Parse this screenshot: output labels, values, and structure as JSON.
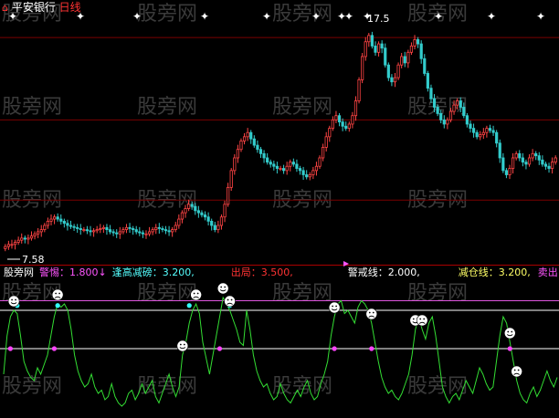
{
  "header": {
    "stock_name": "平安银行",
    "period": "日线",
    "name_color": "#ffffff",
    "period_color": "#ff3333"
  },
  "watermark": {
    "text": "股旁网",
    "color": "#3a3a3a"
  },
  "price_panel": {
    "high_label": "17.5",
    "low_label": "7.58",
    "star_color": "#ffffff",
    "up_color": "#ff4444",
    "down_color": "#33cccc",
    "grid_color": "#7a0000"
  },
  "indicator_panel": {
    "legend": [
      {
        "name": "股旁网",
        "value": "",
        "color": "#ffffff"
      },
      {
        "name": "警惕",
        "value": "1.800↓",
        "color": "#ff55ff"
      },
      {
        "name": "逢高减磅",
        "value": "3.200,",
        "color": "#55ffff"
      },
      {
        "name": "出局",
        "value": "3.500,",
        "color": "#ff3333"
      },
      {
        "name": "警戒线",
        "value": "2.000,",
        "color": "#ffffff"
      },
      {
        "name": "减仓线",
        "value": "3.200,",
        "color": "#ffff66"
      },
      {
        "name": "卖出",
        "value": "",
        "color": "#ff55ff"
      }
    ],
    "line_color": "#33dd33",
    "magenta_level_color": "#dd55dd",
    "white_level_color": "#ffffff"
  },
  "chart_data": [
    {
      "type": "candlestick",
      "title": "平安银行 日线",
      "ylim": [
        7.0,
        18.5
      ],
      "price_markers": {
        "max": 17.5,
        "min": 7.58
      },
      "closes": [
        7.6,
        7.7,
        7.7,
        7.8,
        7.9,
        8.0,
        7.95,
        8.0,
        8.1,
        8.2,
        8.3,
        8.4,
        8.6,
        8.8,
        8.9,
        9.0,
        8.9,
        8.8,
        8.7,
        8.6,
        8.55,
        8.5,
        8.45,
        8.4,
        8.4,
        8.35,
        8.3,
        8.35,
        8.4,
        8.45,
        8.5,
        8.4,
        8.3,
        8.25,
        8.2,
        8.3,
        8.4,
        8.5,
        8.45,
        8.4,
        8.3,
        8.25,
        8.2,
        8.2,
        8.3,
        8.4,
        8.5,
        8.45,
        8.4,
        8.35,
        8.3,
        8.4,
        8.6,
        8.9,
        9.2,
        9.4,
        9.6,
        9.5,
        9.3,
        9.2,
        9.1,
        9.0,
        8.8,
        8.6,
        8.4,
        8.6,
        9.0,
        9.6,
        10.4,
        11.2,
        11.8,
        12.2,
        12.6,
        12.8,
        13.0,
        12.7,
        12.4,
        12.2,
        12.0,
        11.8,
        11.6,
        11.5,
        11.4,
        11.3,
        11.3,
        11.2,
        11.4,
        11.6,
        11.5,
        11.3,
        11.2,
        11.0,
        10.9,
        11.0,
        11.2,
        11.4,
        11.8,
        12.3,
        12.8,
        13.2,
        13.6,
        13.8,
        13.5,
        13.3,
        13.2,
        13.4,
        13.8,
        14.5,
        15.5,
        16.6,
        17.3,
        17.6,
        17.1,
        16.8,
        17.2,
        17.0,
        16.2,
        15.6,
        15.4,
        15.6,
        16.2,
        16.6,
        16.3,
        16.8,
        17.1,
        17.4,
        17.2,
        16.5,
        15.8,
        15.1,
        14.6,
        14.2,
        13.9,
        13.6,
        13.4,
        13.6,
        14.0,
        14.3,
        14.5,
        14.2,
        13.8,
        13.4,
        13.2,
        13.0,
        12.8,
        12.9,
        13.0,
        13.2,
        13.1,
        13.0,
        12.5,
        11.8,
        11.2,
        11.0,
        11.3,
        11.8,
        12.0,
        11.8,
        11.6,
        11.5,
        11.8,
        12.0,
        11.9,
        11.7,
        11.5,
        11.4,
        11.3,
        11.6,
        11.8
      ]
    },
    {
      "type": "line",
      "title": "股旁网",
      "ylim": [
        0,
        4
      ],
      "levels": [
        {
          "name": "出局",
          "value": 3.5
        },
        {
          "name": "减仓线",
          "value": 3.2
        },
        {
          "name": "警戒线",
          "value": 2.0
        }
      ],
      "values": [
        1.2,
        2.4,
        3.0,
        3.2,
        3.1,
        2.4,
        1.6,
        1.3,
        1.1,
        1.0,
        1.4,
        1.2,
        1.5,
        1.8,
        2.4,
        3.0,
        3.4,
        3.3,
        3.4,
        3.2,
        2.6,
        1.8,
        1.3,
        1.0,
        0.8,
        0.9,
        1.2,
        0.8,
        0.6,
        0.7,
        0.4,
        0.5,
        0.9,
        0.5,
        0.3,
        0.2,
        0.3,
        0.6,
        0.7,
        0.4,
        0.6,
        0.9,
        0.6,
        0.8,
        1.0,
        0.5,
        0.3,
        0.6,
        0.9,
        1.2,
        0.8,
        0.5,
        0.8,
        1.8,
        2.2,
        2.8,
        3.2,
        3.4,
        3.1,
        2.2,
        1.7,
        1.2,
        1.8,
        2.4,
        3.0,
        3.6,
        3.4,
        3.2,
        2.9,
        2.6,
        2.2,
        2.1,
        3.2,
        2.6,
        1.8,
        1.3,
        1.0,
        0.8,
        0.9,
        0.6,
        0.4,
        0.5,
        0.9,
        0.6,
        0.4,
        0.3,
        0.5,
        0.7,
        0.5,
        0.8,
        1.0,
        0.6,
        0.4,
        0.5,
        0.9,
        1.2,
        1.6,
        2.4,
        3.0,
        3.4,
        3.5,
        3.1,
        3.2,
        3.0,
        2.8,
        3.3,
        3.5,
        3.4,
        3.2,
        2.8,
        2.2,
        1.6,
        1.1,
        0.8,
        0.6,
        0.7,
        0.5,
        0.4,
        0.6,
        0.9,
        1.2,
        1.8,
        2.6,
        3.0,
        2.6,
        2.3,
        2.8,
        3.0,
        2.4,
        1.6,
        0.8,
        0.5,
        0.3,
        0.5,
        0.6,
        0.4,
        0.7,
        1.0,
        0.8,
        0.6,
        1.0,
        1.4,
        1.2,
        0.9,
        0.7,
        0.8,
        1.6,
        2.4,
        3.0,
        2.8,
        2.2,
        1.6,
        1.0,
        0.6,
        0.4,
        0.3,
        0.6,
        0.8,
        0.5,
        0.7,
        1.0,
        1.3,
        1.0,
        0.8,
        1.1
      ],
      "smiley_indices": [
        3,
        16,
        53,
        57,
        65,
        67,
        98,
        109,
        122,
        124,
        150,
        152
      ],
      "markers_magenta": [
        2,
        15,
        53,
        64,
        98,
        109,
        150
      ],
      "markers_cyan": [
        4,
        16,
        55,
        67
      ]
    }
  ]
}
